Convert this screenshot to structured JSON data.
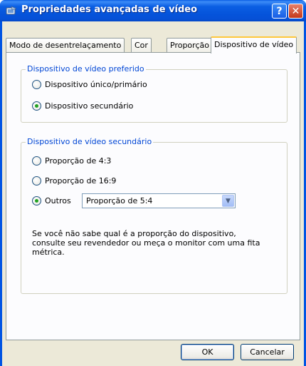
{
  "window": {
    "title": "Propriedades avançadas de vídeo",
    "help_label": "?",
    "close_label": "✕"
  },
  "tabs": [
    {
      "label": "Modo de desentrelaçamento"
    },
    {
      "label": "Cor"
    },
    {
      "label": "Proporção"
    },
    {
      "label": "Dispositivo de vídeo",
      "active": true
    }
  ],
  "preferred_group": {
    "title": "Dispositivo de vídeo preferido",
    "options": [
      {
        "label": "Dispositivo único/primário",
        "checked": false
      },
      {
        "label": "Dispositivo secundário",
        "checked": true
      }
    ]
  },
  "secondary_group": {
    "title": "Dispositivo de vídeo secundário",
    "options": [
      {
        "label": "Proporção de 4:3",
        "checked": false
      },
      {
        "label": "Proporção de 16:9",
        "checked": false
      },
      {
        "label": "Outros",
        "checked": true
      }
    ],
    "other_select_value": "Proporção de 5:4",
    "note": "Se você não sabe qual é a proporção do dispositivo, consulte seu revendedor ou meça o monitor com uma fita métrica."
  },
  "buttons": {
    "ok": "OK",
    "cancel": "Cancelar"
  }
}
